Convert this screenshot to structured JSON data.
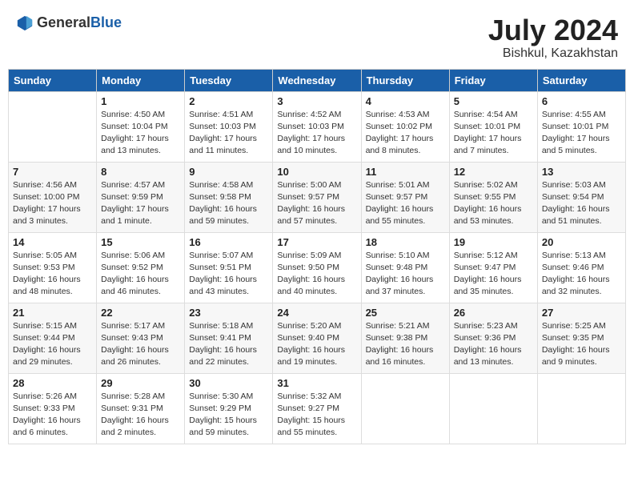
{
  "logo": {
    "text_general": "General",
    "text_blue": "Blue"
  },
  "header": {
    "month": "July 2024",
    "location": "Bishkul, Kazakhstan"
  },
  "weekdays": [
    "Sunday",
    "Monday",
    "Tuesday",
    "Wednesday",
    "Thursday",
    "Friday",
    "Saturday"
  ],
  "weeks": [
    [
      {
        "day": "",
        "info": ""
      },
      {
        "day": "1",
        "info": "Sunrise: 4:50 AM\nSunset: 10:04 PM\nDaylight: 17 hours\nand 13 minutes."
      },
      {
        "day": "2",
        "info": "Sunrise: 4:51 AM\nSunset: 10:03 PM\nDaylight: 17 hours\nand 11 minutes."
      },
      {
        "day": "3",
        "info": "Sunrise: 4:52 AM\nSunset: 10:03 PM\nDaylight: 17 hours\nand 10 minutes."
      },
      {
        "day": "4",
        "info": "Sunrise: 4:53 AM\nSunset: 10:02 PM\nDaylight: 17 hours\nand 8 minutes."
      },
      {
        "day": "5",
        "info": "Sunrise: 4:54 AM\nSunset: 10:01 PM\nDaylight: 17 hours\nand 7 minutes."
      },
      {
        "day": "6",
        "info": "Sunrise: 4:55 AM\nSunset: 10:01 PM\nDaylight: 17 hours\nand 5 minutes."
      }
    ],
    [
      {
        "day": "7",
        "info": "Sunrise: 4:56 AM\nSunset: 10:00 PM\nDaylight: 17 hours\nand 3 minutes."
      },
      {
        "day": "8",
        "info": "Sunrise: 4:57 AM\nSunset: 9:59 PM\nDaylight: 17 hours\nand 1 minute."
      },
      {
        "day": "9",
        "info": "Sunrise: 4:58 AM\nSunset: 9:58 PM\nDaylight: 16 hours\nand 59 minutes."
      },
      {
        "day": "10",
        "info": "Sunrise: 5:00 AM\nSunset: 9:57 PM\nDaylight: 16 hours\nand 57 minutes."
      },
      {
        "day": "11",
        "info": "Sunrise: 5:01 AM\nSunset: 9:57 PM\nDaylight: 16 hours\nand 55 minutes."
      },
      {
        "day": "12",
        "info": "Sunrise: 5:02 AM\nSunset: 9:55 PM\nDaylight: 16 hours\nand 53 minutes."
      },
      {
        "day": "13",
        "info": "Sunrise: 5:03 AM\nSunset: 9:54 PM\nDaylight: 16 hours\nand 51 minutes."
      }
    ],
    [
      {
        "day": "14",
        "info": "Sunrise: 5:05 AM\nSunset: 9:53 PM\nDaylight: 16 hours\nand 48 minutes."
      },
      {
        "day": "15",
        "info": "Sunrise: 5:06 AM\nSunset: 9:52 PM\nDaylight: 16 hours\nand 46 minutes."
      },
      {
        "day": "16",
        "info": "Sunrise: 5:07 AM\nSunset: 9:51 PM\nDaylight: 16 hours\nand 43 minutes."
      },
      {
        "day": "17",
        "info": "Sunrise: 5:09 AM\nSunset: 9:50 PM\nDaylight: 16 hours\nand 40 minutes."
      },
      {
        "day": "18",
        "info": "Sunrise: 5:10 AM\nSunset: 9:48 PM\nDaylight: 16 hours\nand 37 minutes."
      },
      {
        "day": "19",
        "info": "Sunrise: 5:12 AM\nSunset: 9:47 PM\nDaylight: 16 hours\nand 35 minutes."
      },
      {
        "day": "20",
        "info": "Sunrise: 5:13 AM\nSunset: 9:46 PM\nDaylight: 16 hours\nand 32 minutes."
      }
    ],
    [
      {
        "day": "21",
        "info": "Sunrise: 5:15 AM\nSunset: 9:44 PM\nDaylight: 16 hours\nand 29 minutes."
      },
      {
        "day": "22",
        "info": "Sunrise: 5:17 AM\nSunset: 9:43 PM\nDaylight: 16 hours\nand 26 minutes."
      },
      {
        "day": "23",
        "info": "Sunrise: 5:18 AM\nSunset: 9:41 PM\nDaylight: 16 hours\nand 22 minutes."
      },
      {
        "day": "24",
        "info": "Sunrise: 5:20 AM\nSunset: 9:40 PM\nDaylight: 16 hours\nand 19 minutes."
      },
      {
        "day": "25",
        "info": "Sunrise: 5:21 AM\nSunset: 9:38 PM\nDaylight: 16 hours\nand 16 minutes."
      },
      {
        "day": "26",
        "info": "Sunrise: 5:23 AM\nSunset: 9:36 PM\nDaylight: 16 hours\nand 13 minutes."
      },
      {
        "day": "27",
        "info": "Sunrise: 5:25 AM\nSunset: 9:35 PM\nDaylight: 16 hours\nand 9 minutes."
      }
    ],
    [
      {
        "day": "28",
        "info": "Sunrise: 5:26 AM\nSunset: 9:33 PM\nDaylight: 16 hours\nand 6 minutes."
      },
      {
        "day": "29",
        "info": "Sunrise: 5:28 AM\nSunset: 9:31 PM\nDaylight: 16 hours\nand 2 minutes."
      },
      {
        "day": "30",
        "info": "Sunrise: 5:30 AM\nSunset: 9:29 PM\nDaylight: 15 hours\nand 59 minutes."
      },
      {
        "day": "31",
        "info": "Sunrise: 5:32 AM\nSunset: 9:27 PM\nDaylight: 15 hours\nand 55 minutes."
      },
      {
        "day": "",
        "info": ""
      },
      {
        "day": "",
        "info": ""
      },
      {
        "day": "",
        "info": ""
      }
    ]
  ]
}
